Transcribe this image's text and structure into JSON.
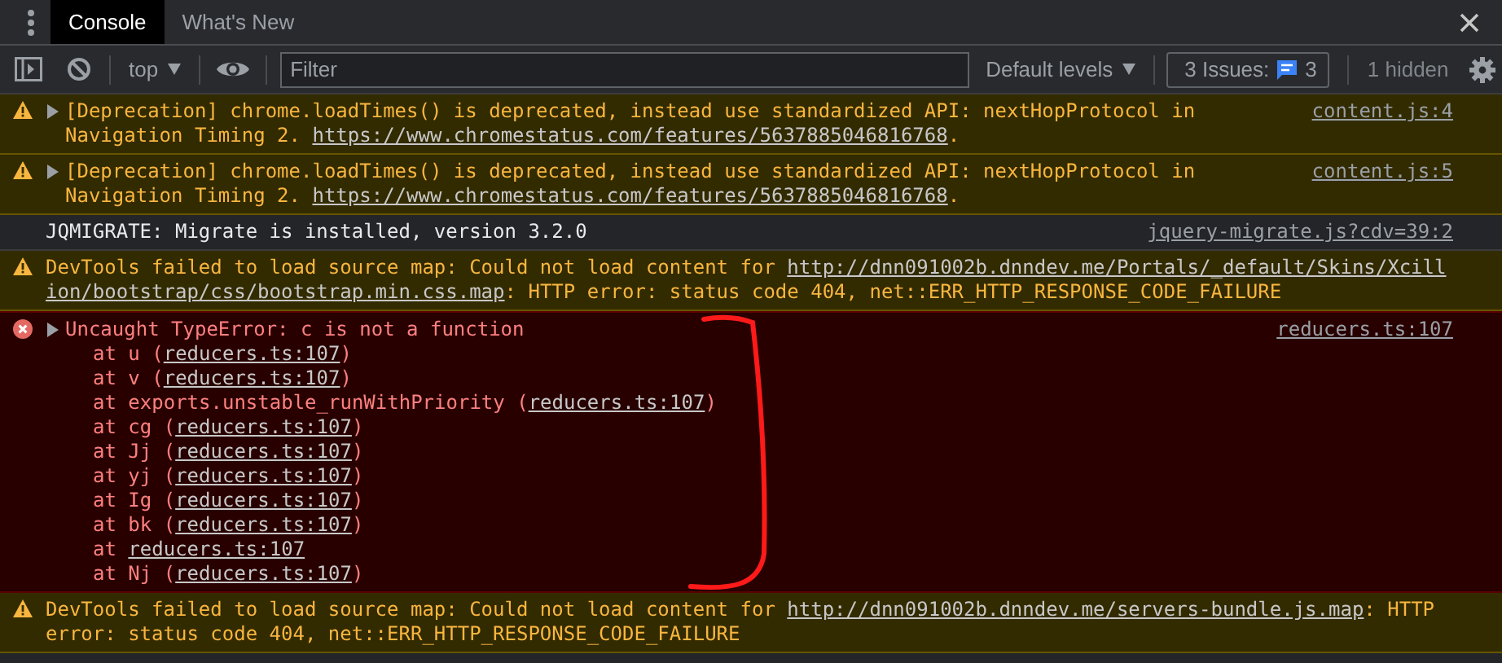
{
  "tabs": [
    {
      "label": "Console",
      "selected": true
    },
    {
      "label": "What's New",
      "selected": false
    }
  ],
  "toolbar": {
    "context": "top",
    "filter": {
      "placeholder": "Filter"
    },
    "levels": "Default levels",
    "issues": {
      "label": "3 Issues:",
      "count": "3"
    },
    "hidden": "1 hidden"
  },
  "messages": [
    {
      "kind": "warning",
      "expanded": false,
      "source": "content.js:4",
      "parts": [
        {
          "kind": "text",
          "text": "[Deprecation] chrome.loadTimes() is deprecated, instead use standardized API: nextHopProtocol in Navigation Timing 2. "
        },
        {
          "kind": "link",
          "text": "https://www.chromestatus.com/features/5637885046816768"
        },
        {
          "kind": "text",
          "text": "."
        }
      ]
    },
    {
      "kind": "warning",
      "expanded": false,
      "source": "content.js:5",
      "parts": [
        {
          "kind": "text",
          "text": "[Deprecation] chrome.loadTimes() is deprecated, instead use standardized API: nextHopProtocol in Navigation Timing 2. "
        },
        {
          "kind": "link",
          "text": "https://www.chromestatus.com/features/5637885046816768"
        },
        {
          "kind": "text",
          "text": "."
        }
      ]
    },
    {
      "kind": "info",
      "source": "jquery-migrate.js?cdv=39:2",
      "parts": [
        {
          "kind": "text",
          "text": "JQMIGRATE: Migrate is installed, version 3.2.0"
        }
      ]
    },
    {
      "kind": "warning",
      "parts": [
        {
          "kind": "text",
          "text": "DevTools failed to load source map: Could not load content for "
        },
        {
          "kind": "link",
          "text": "http://dnn091002b.dnndev.me/Portals/_default/Skins/Xcill"
        },
        {
          "kind": "link",
          "text": "ion/bootstrap/css/bootstrap.min.css.map"
        },
        {
          "kind": "text",
          "text": ": HTTP error: status code 404, net::ERR_HTTP_RESPONSE_CODE_FAILURE"
        }
      ]
    },
    {
      "kind": "error",
      "expanded": false,
      "source": "reducers.ts:107",
      "parts": [
        {
          "kind": "text",
          "text": "Uncaught TypeError: c is not a function"
        }
      ],
      "stack": [
        [
          {
            "kind": "text",
            "text": "at u ("
          },
          {
            "kind": "link",
            "text": "reducers.ts:107"
          },
          {
            "kind": "text",
            "text": ")"
          }
        ],
        [
          {
            "kind": "text",
            "text": "at v ("
          },
          {
            "kind": "link",
            "text": "reducers.ts:107"
          },
          {
            "kind": "text",
            "text": ")"
          }
        ],
        [
          {
            "kind": "text",
            "text": "at exports.unstable_runWithPriority ("
          },
          {
            "kind": "link",
            "text": "reducers.ts:107"
          },
          {
            "kind": "text",
            "text": ")"
          }
        ],
        [
          {
            "kind": "text",
            "text": "at cg ("
          },
          {
            "kind": "link",
            "text": "reducers.ts:107"
          },
          {
            "kind": "text",
            "text": ")"
          }
        ],
        [
          {
            "kind": "text",
            "text": "at Jj ("
          },
          {
            "kind": "link",
            "text": "reducers.ts:107"
          },
          {
            "kind": "text",
            "text": ")"
          }
        ],
        [
          {
            "kind": "text",
            "text": "at yj ("
          },
          {
            "kind": "link",
            "text": "reducers.ts:107"
          },
          {
            "kind": "text",
            "text": ")"
          }
        ],
        [
          {
            "kind": "text",
            "text": "at Ig ("
          },
          {
            "kind": "link",
            "text": "reducers.ts:107"
          },
          {
            "kind": "text",
            "text": ")"
          }
        ],
        [
          {
            "kind": "text",
            "text": "at bk ("
          },
          {
            "kind": "link",
            "text": "reducers.ts:107"
          },
          {
            "kind": "text",
            "text": ")"
          }
        ],
        [
          {
            "kind": "text",
            "text": "at "
          },
          {
            "kind": "link",
            "text": "reducers.ts:107"
          }
        ],
        [
          {
            "kind": "text",
            "text": "at Nj ("
          },
          {
            "kind": "link",
            "text": "reducers.ts:107"
          },
          {
            "kind": "text",
            "text": ")"
          }
        ]
      ]
    },
    {
      "kind": "warning",
      "parts": [
        {
          "kind": "text",
          "text": "DevTools failed to load source map: Could not load content for "
        },
        {
          "kind": "link",
          "text": "http://dnn091002b.dnndev.me/servers-bundle.js.map"
        },
        {
          "kind": "text",
          "text": ": HTTP error: status code 404, net::ERR_HTTP_RESPONSE_CODE_FAILURE"
        }
      ]
    }
  ],
  "annotation": {
    "kind": "bracket"
  }
}
